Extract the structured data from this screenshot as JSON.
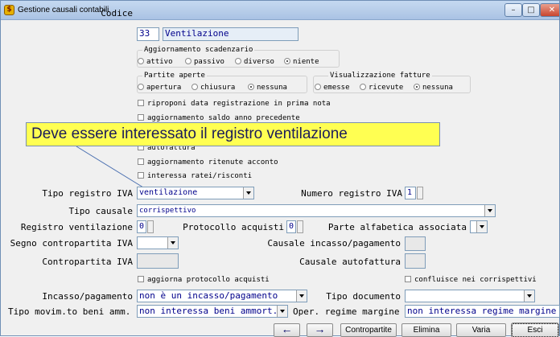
{
  "window": {
    "title": "Gestione causali contabili",
    "icon": "app-icon",
    "controls": {
      "minimize": "–",
      "maximize": "□",
      "close": "✕"
    }
  },
  "codice": {
    "label": "Codice",
    "code": "33",
    "description": "Ventilazione"
  },
  "scadenzario": {
    "caption": "Aggiornamento scadenzario",
    "options": [
      "attivo",
      "passivo",
      "diverso",
      "niente"
    ],
    "selected": "niente"
  },
  "partite": {
    "caption": "Partite aperte",
    "options": [
      "apertura",
      "chiusura",
      "nessuna"
    ],
    "selected": "nessuna"
  },
  "fatture": {
    "caption": "Visualizzazione fatture",
    "options": [
      "emesse",
      "ricevute",
      "nessuna"
    ],
    "selected": "nessuna"
  },
  "checkboxes": {
    "riproponi": "riproponi data registrazione in prima nota",
    "saldo": "aggiornamento saldo anno precedente",
    "autofattura": "autofattura",
    "ritenute": "aggiornamento ritenute acconto",
    "ratei": "interessa ratei/risconti",
    "protocollo": "aggiorna protocollo acquisti",
    "corrispettivi": "confluisce nei corrispettivi"
  },
  "callout": "Deve essere interessato il registro ventilazione",
  "tipo_registro_iva": {
    "label": "Tipo registro IVA",
    "value": "ventilazione"
  },
  "numero_registro_iva": {
    "label": "Numero registro IVA",
    "value": "1"
  },
  "tipo_causale": {
    "label": "Tipo causale",
    "value": "corrispettivo"
  },
  "registro_ventilazione": {
    "label": "Registro ventilazione",
    "value": "0"
  },
  "protocollo_acquisti": {
    "label": "Protocollo acquisti",
    "value": "0"
  },
  "parte_alfabetica": {
    "label": "Parte alfabetica associata",
    "value": ""
  },
  "segno_contropartita": {
    "label": "Segno contropartita IVA",
    "value": ""
  },
  "causale_incasso": {
    "label": "Causale incasso/pagamento",
    "value": ""
  },
  "contropartita_iva": {
    "label": "Contropartita IVA",
    "value": ""
  },
  "causale_autofattura": {
    "label": "Causale autofattura",
    "value": ""
  },
  "incasso_pagamento": {
    "label": "Incasso/pagamento",
    "value": "non è un incasso/pagamento"
  },
  "tipo_documento": {
    "label": "Tipo documento",
    "value": ""
  },
  "tipo_movim": {
    "label": "Tipo movim.to beni amm.",
    "value": "non interessa beni ammort."
  },
  "oper_regime": {
    "label": "Oper. regime margine",
    "value": "non interessa regime margine"
  },
  "buttons": {
    "prev": "←",
    "next": "→",
    "contropartite": "Contropartite",
    "elimina": "Elimina",
    "varia": "Varia",
    "esci": "Esci"
  }
}
